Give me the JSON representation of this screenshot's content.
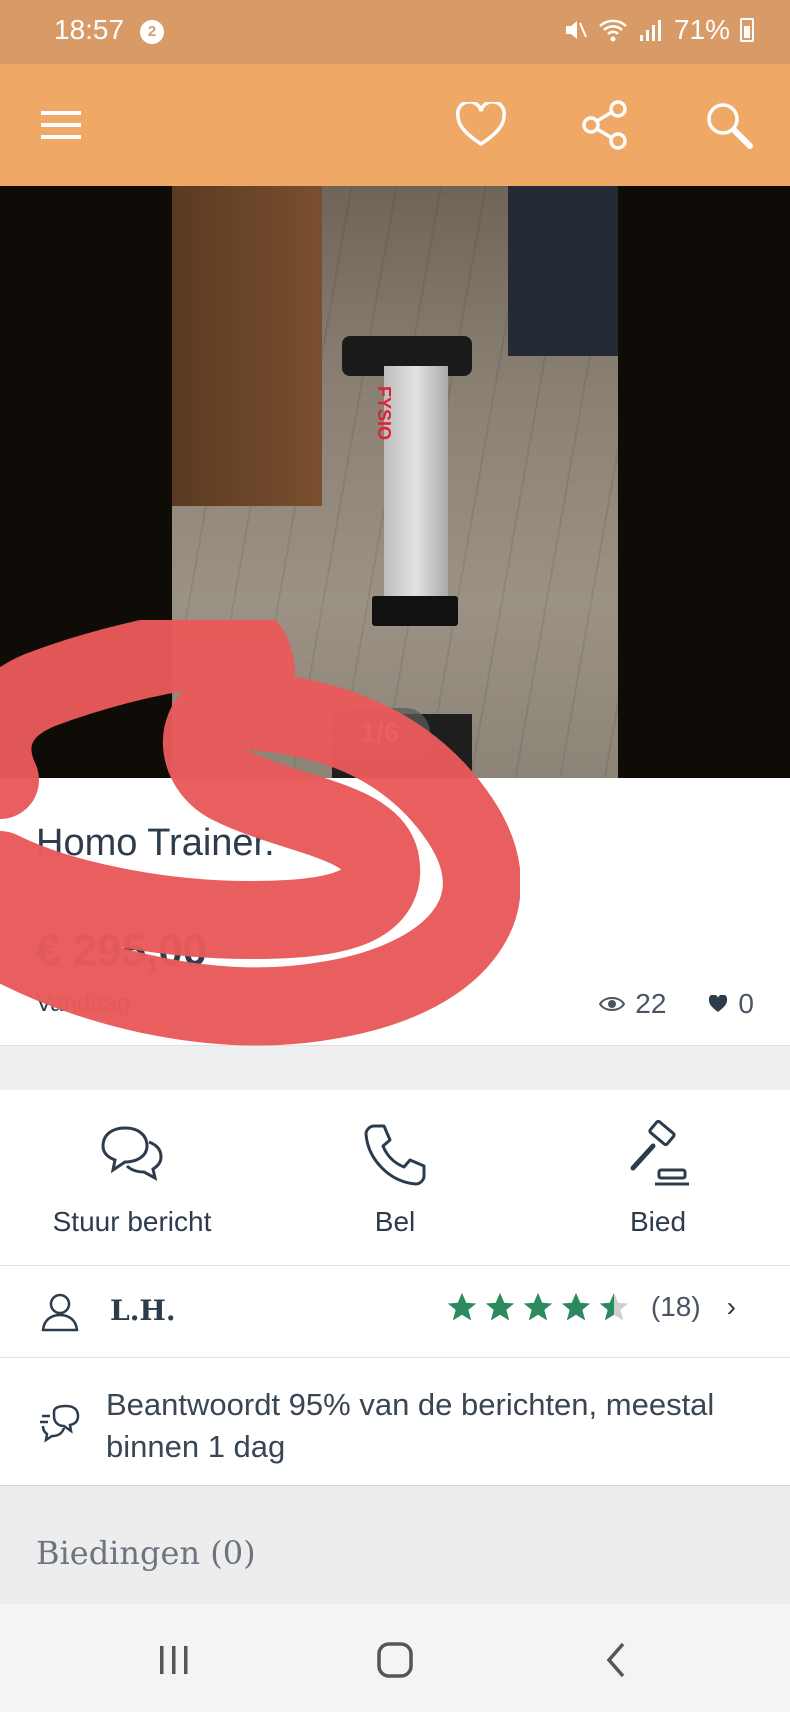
{
  "status_bar": {
    "time": "18:57",
    "badge": "2",
    "battery": "71%",
    "icons": [
      "mute-icon",
      "wifi-icon",
      "signal-icon",
      "battery-icon"
    ]
  },
  "app_bar": {
    "icons": [
      "menu-icon",
      "heart-icon",
      "share-icon",
      "search-icon"
    ],
    "color": "#f0a867"
  },
  "photo": {
    "counter": "1/6",
    "brand_text": "FYSIO"
  },
  "listing": {
    "title": "Homo Trainer.",
    "price": "€ 295,00",
    "date": "Vandaag",
    "views": "22",
    "favorites": "0"
  },
  "actions": [
    {
      "label": "Stuur bericht",
      "icon": "chat-icon"
    },
    {
      "label": "Bel",
      "icon": "phone-icon"
    },
    {
      "label": "Bied",
      "icon": "gavel-icon"
    }
  ],
  "seller": {
    "name": "L.H.",
    "rating": 4.5,
    "rating_color": "#2b8a5e",
    "review_count": "(18)",
    "chevron": "›"
  },
  "response": {
    "text": "Beantwoordt 95% van de berichten, meestal binnen 1 dag"
  },
  "bids": {
    "title": "Biedingen (0)"
  },
  "navbar": {
    "icons": [
      "recents-icon",
      "home-icon",
      "back-icon"
    ]
  },
  "annotation_color": "#e85a5a"
}
